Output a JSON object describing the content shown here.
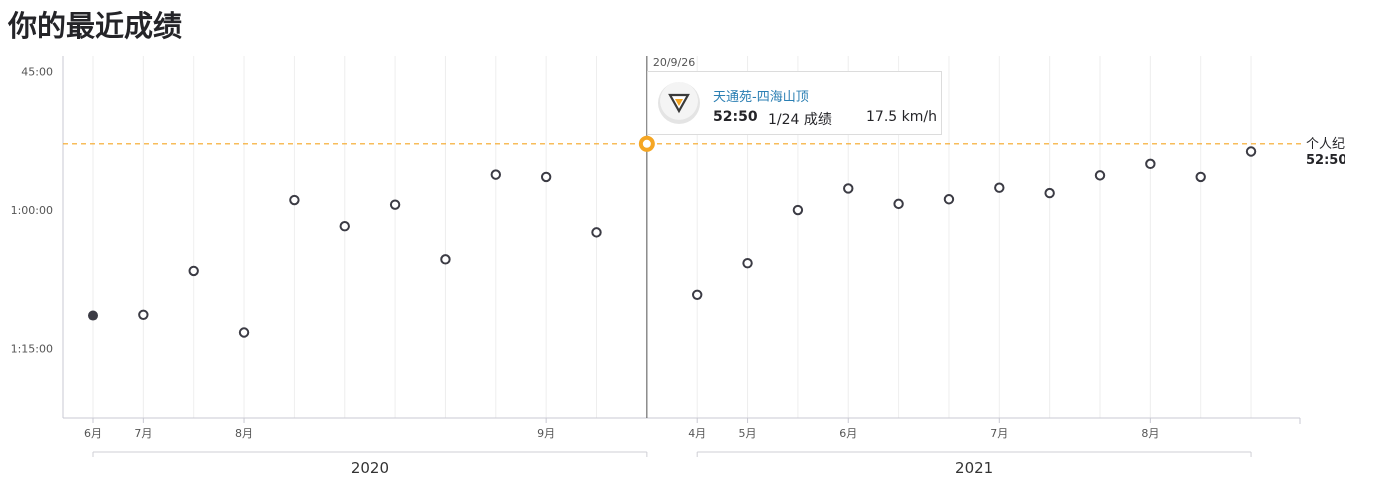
{
  "page": {
    "title": "你的最近成绩"
  },
  "colors": {
    "accent": "#f5a623",
    "marker": "#3b3b44",
    "grid": "#eeeeee",
    "segment_link": "#2b7fb3"
  },
  "chart_data": {
    "type": "scatter",
    "y_axis": {
      "ticks": [
        "45:00",
        "1:00:00",
        "1:15:00"
      ],
      "tick_seconds": [
        2700,
        3600,
        4500
      ],
      "range_seconds": [
        2600,
        4950
      ],
      "inverted": true
    },
    "x_ticks": [
      {
        "label": "6月",
        "point": 0
      },
      {
        "label": "7月",
        "point": 1
      },
      {
        "label": "8月",
        "point": 3
      },
      {
        "label": "9月",
        "point": 9
      },
      {
        "label": "4月",
        "point": 12
      },
      {
        "label": "5月",
        "point": 13
      },
      {
        "label": "6月",
        "point": 15
      },
      {
        "label": "7月",
        "point": 18
      },
      {
        "label": "8月",
        "point": 21
      }
    ],
    "years": [
      {
        "label": "2020",
        "from": 0,
        "to": 11
      },
      {
        "label": "2021",
        "from": 12,
        "to": 23
      }
    ],
    "points_seconds": [
      4285,
      4280,
      3995,
      4395,
      3535,
      3705,
      3565,
      3920,
      3370,
      3385,
      3745,
      3170,
      4150,
      3945,
      3600,
      3460,
      3560,
      3530,
      3455,
      3490,
      3375,
      3300,
      3385,
      3220
    ],
    "filled_point": 0,
    "highlight_point": 11,
    "personal_record": {
      "label": "个人纪",
      "value": "52:50",
      "seconds": 3170
    },
    "tooltip": {
      "date": "20/9/26",
      "segment": "天通苑-四海山顶",
      "time": "52:50",
      "rank": "1/24 成绩",
      "speed": "17.5 km/h"
    }
  }
}
